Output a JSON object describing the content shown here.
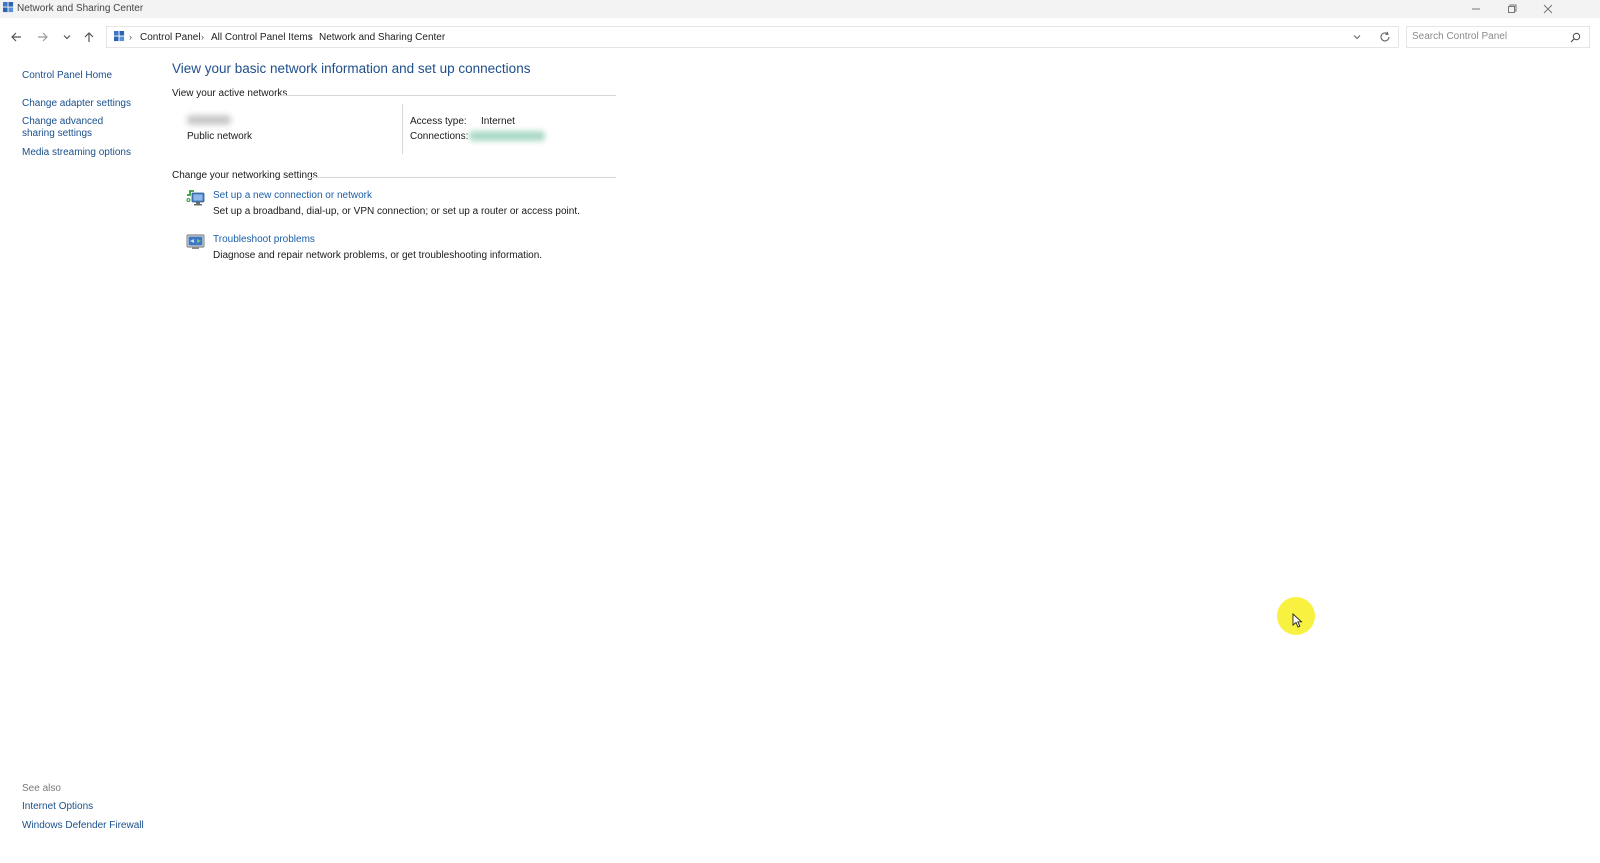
{
  "window": {
    "title": "Network and Sharing Center"
  },
  "nav": {
    "breadcrumbs": [
      "Control Panel",
      "All Control Panel Items",
      "Network and Sharing Center"
    ]
  },
  "search": {
    "placeholder": "Search Control Panel"
  },
  "sidebar": {
    "items": [
      {
        "label": "Control Panel Home"
      },
      {
        "label": "Change adapter settings"
      },
      {
        "label": "Change advanced sharing settings"
      },
      {
        "label": "Media streaming options"
      }
    ],
    "see_also_label": "See also",
    "see_also": [
      {
        "label": "Internet Options"
      },
      {
        "label": "Windows Defender Firewall"
      }
    ]
  },
  "main": {
    "heading": "View your basic network information and set up connections",
    "active_networks_label": "View your active networks",
    "network": {
      "type": "Public network",
      "access_type_label": "Access type:",
      "access_type_value": "Internet",
      "connections_label": "Connections:"
    },
    "change_settings_label": "Change your networking settings",
    "tasks": [
      {
        "icon": "new-connection-icon",
        "title": "Set up a new connection or network",
        "description": "Set up a broadband, dial-up, or VPN connection; or set up a router or access point."
      },
      {
        "icon": "troubleshoot-icon",
        "title": "Troubleshoot problems",
        "description": "Diagnose and repair network problems, or get troubleshooting information."
      }
    ]
  },
  "colors": {
    "link": "#1a5ea8",
    "heading": "#1e4e8c",
    "cursor_highlight": "#f7ef2a"
  }
}
